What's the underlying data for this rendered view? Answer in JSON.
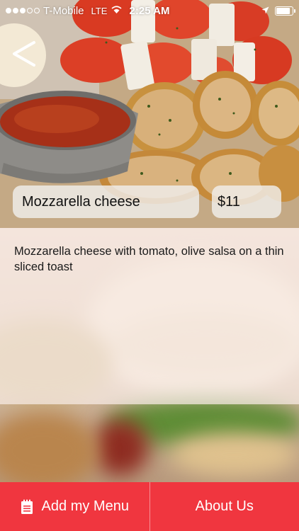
{
  "status_bar": {
    "signal_filled": 3,
    "signal_total": 5,
    "carrier": "T-Mobile",
    "network": "LTE",
    "time": "2:25 AM",
    "battery_level": 0.85,
    "icons": [
      "wifi-icon",
      "location-arrow-icon",
      "battery-icon"
    ]
  },
  "navigation": {
    "back_icon": "back-chevron-icon"
  },
  "item": {
    "name": "Mozzarella cheese",
    "price": "$11",
    "description": "Mozzarella cheese with tomato, olive salsa on a thin sliced toast"
  },
  "tab_bar": {
    "add_menu_label": "Add my Menu",
    "add_menu_icon": "notepad-icon",
    "about_label": "About Us"
  },
  "colors": {
    "accent": "#f0363f",
    "pill_background": "#f0eeec"
  }
}
